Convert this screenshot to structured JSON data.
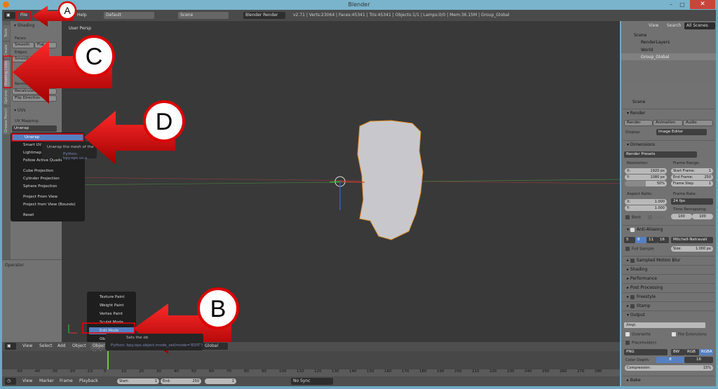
{
  "window": {
    "title": "Blender",
    "close": "✕",
    "minimize": "–",
    "maximize": "□"
  },
  "info": {
    "menus": [
      "File",
      "Help"
    ],
    "layout": "Default",
    "scene": "Scene",
    "engine": "Blender Render",
    "stats": "v2.71 | Verts:23064 | Faces:45341 | Tris:45341 | Objects:1/1 | Lamps:0/0 | Mem:36.15M | Group_Global"
  },
  "toolshelf": {
    "tabs": [
      "Tools",
      "Create",
      "Shading / UVs",
      "Options",
      "Grease Pencil"
    ],
    "shading": {
      "title": "Shading",
      "faces": "Faces:",
      "smooth": "Smooth",
      "flat": "Flat",
      "edges": "Edges:",
      "edge_smooth": "Smooth",
      "normals": "Normals:",
      "recalculate": "Recalculate",
      "flip": "Flip Direction"
    },
    "uvs": {
      "title": "UVs",
      "mapping_label": "UV Mapping:",
      "mapping_value": "Unwrap"
    },
    "operator": "Operator"
  },
  "uv_menu": {
    "items": [
      "Unwrap",
      "Smart UV Project",
      "Lightmap Pack",
      "Follow Active Quads",
      "Cube Projection",
      "Cylinder Projection",
      "Sphere Projection",
      "Project From View",
      "Project from View (Bounds)",
      "Reset"
    ],
    "tooltip": "Unwrap the mesh of the",
    "tooltip_python": "Python: bpy.ops.uv.u"
  },
  "viewport": {
    "label": "User Persp"
  },
  "mode_menu": {
    "items": [
      "Texture Paint",
      "Weight Paint",
      "Vertex Paint",
      "Sculpt Mode",
      "Edit Mode",
      "Object Mode"
    ],
    "tooltip": "Sets the ob",
    "tooltip_python": "Python: bpy.ops.object.mode_set(mode='EDIT')"
  },
  "header3d": {
    "menus": [
      "View",
      "Select",
      "Add",
      "Object"
    ],
    "mode": "Object Mode",
    "orientation": "Global"
  },
  "timeline": {
    "ticks": [
      -50,
      -40,
      -30,
      -20,
      -10,
      0,
      10,
      20,
      30,
      40,
      50,
      60,
      70,
      80,
      90,
      100,
      110,
      120,
      130,
      140,
      150,
      160,
      170,
      180,
      190,
      200,
      210,
      220,
      230,
      240,
      250,
      260,
      270,
      280
    ],
    "current_frame": 1,
    "menus": [
      "View",
      "Marker",
      "Frame",
      "Playback"
    ],
    "start_label": "Start:",
    "start": "1",
    "end_label": "End:",
    "end": "250",
    "frame": "1",
    "sync": "No Sync"
  },
  "outliner": {
    "view": "View",
    "search": "Search",
    "filter": "All Scenes",
    "items": [
      "Scene",
      "RenderLayers",
      "World",
      "Group_Global"
    ]
  },
  "properties": {
    "context": "Scene",
    "render": {
      "title": "Render",
      "render": "Render",
      "animation": "Animation",
      "audio": "Audio",
      "display_label": "Display:",
      "display": "Image Editor"
    },
    "dimensions": {
      "title": "Dimensions",
      "presets": "Render Presets",
      "resolution": "Resolution:",
      "res_x": "X:",
      "res_x_val": "1920 px",
      "res_y": "Y:",
      "res_y_val": "1080 px",
      "percent": "50%",
      "frame_range": "Frame Range:",
      "start": "Start Frame:",
      "start_val": "1",
      "end": "End Frame:",
      "end_val": "250",
      "step": "Frame Step:",
      "step_val": "1",
      "aspect": "Aspect Ratio:",
      "asp_x": "X:",
      "asp_x_val": "1.000",
      "asp_y": "Y:",
      "asp_y_val": "1.000",
      "frame_rate": "Frame Rate:",
      "fps": "24 fps",
      "remap": "Time Remapping:",
      "remap_old": "100",
      "remap_new": "100",
      "bord": "Bord",
      "crop": "Crop"
    },
    "aa": {
      "title": "Anti-Aliasing",
      "samples": [
        "5",
        "8",
        "11",
        "16"
      ],
      "selected": "8",
      "filter": "Mitchell-Netravali",
      "full_sample": "Full Sample",
      "size": "Size:",
      "size_val": "1.000 px"
    },
    "collapsed": [
      "Sampled Motion Blur",
      "Shading",
      "Performance",
      "Post Processing",
      "Freestyle",
      "Stamp"
    ],
    "output": {
      "title": "Output",
      "path": "/tmp\\",
      "overwrite": "Overwrite",
      "file_ext": "File Extensions",
      "placeholders": "Placeholders",
      "format": "PNG",
      "bw": "BW",
      "rgb": "RGB",
      "rgba": "RGBA",
      "depth_label": "Color Depth:",
      "depth8": "8",
      "depth16": "16",
      "compression": "Compression:",
      "compression_val": "15%"
    },
    "bake": "Bake"
  },
  "annotations": [
    "A",
    "B",
    "C",
    "D"
  ],
  "colors": {
    "arrow": "#d40000",
    "selection": "#5680c2",
    "mesh_outline": "#e0902a",
    "titlebar": "#79b4cc"
  }
}
